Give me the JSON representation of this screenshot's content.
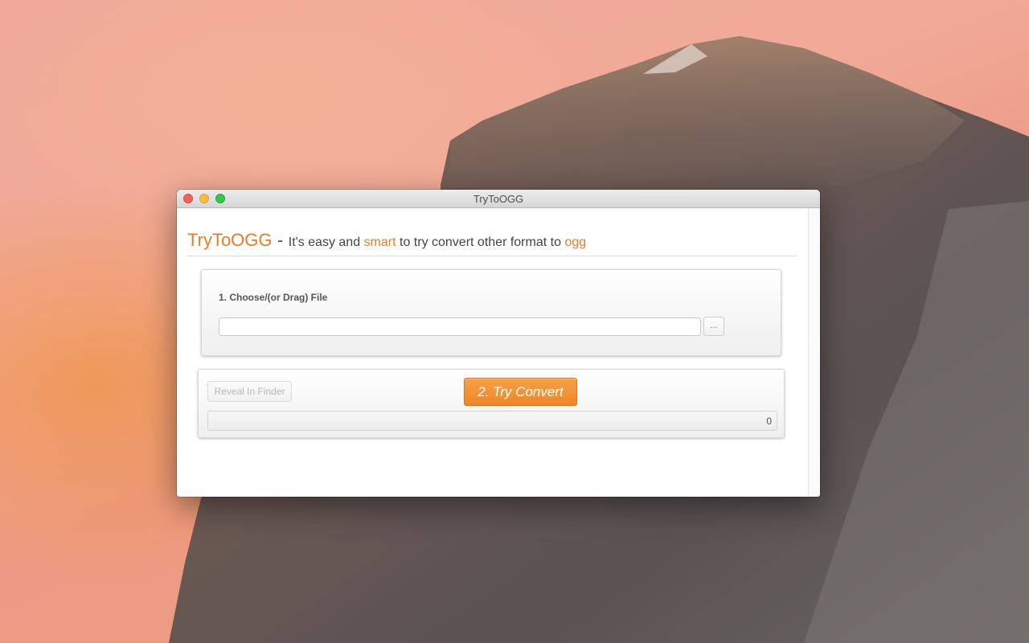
{
  "window": {
    "title": "TryToOGG"
  },
  "headline": {
    "brand": "TryToOGG",
    "separator": "-",
    "part1": "It's easy and",
    "highlight1": "smart",
    "part2": "to try convert other format to",
    "highlight2": "ogg"
  },
  "step1": {
    "label": "1. Choose/(or Drag) File",
    "file_value": "",
    "browse_label": "..."
  },
  "step2": {
    "reveal_label": "Reveal In Finder",
    "convert_label": "2. Try Convert",
    "progress_value": "0",
    "progress_fraction": 0
  },
  "colors": {
    "accent": "#ea7b25",
    "button": "#ef8626"
  }
}
